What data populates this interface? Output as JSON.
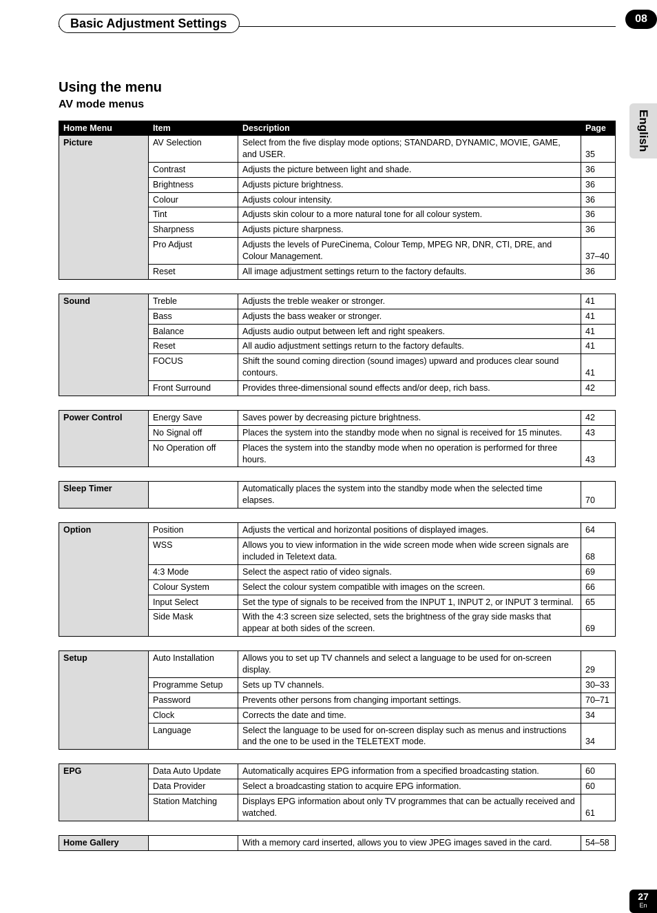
{
  "chapter": {
    "title": "Basic Adjustment Settings",
    "number": "08"
  },
  "side_tab": "English",
  "heading": "Using the menu",
  "subheading": "AV mode menus",
  "columns": {
    "menu": "Home Menu",
    "item": "Item",
    "desc": "Description",
    "page": "Page"
  },
  "tables": [
    {
      "menu": "Picture",
      "has_header": true,
      "rows": [
        {
          "item": "AV Selection",
          "desc": "Select from the five display mode options; STANDARD, DYNAMIC, MOVIE, GAME, and USER.",
          "page": "35"
        },
        {
          "item": "Contrast",
          "desc": "Adjusts the picture between light and shade.",
          "page": "36"
        },
        {
          "item": "Brightness",
          "desc": "Adjusts picture brightness.",
          "page": "36"
        },
        {
          "item": "Colour",
          "desc": "Adjusts colour intensity.",
          "page": "36"
        },
        {
          "item": "Tint",
          "desc": "Adjusts skin colour to a more natural tone for all colour system.",
          "page": "36"
        },
        {
          "item": "Sharpness",
          "desc": "Adjusts picture sharpness.",
          "page": "36"
        },
        {
          "item": "Pro Adjust",
          "desc": "Adjusts the levels of PureCinema, Colour Temp, MPEG NR, DNR, CTI, DRE, and Colour Management.",
          "page": "37–40"
        },
        {
          "item": "Reset",
          "desc": "All image adjustment settings return to the factory defaults.",
          "page": "36"
        }
      ]
    },
    {
      "menu": "Sound",
      "has_header": false,
      "rows": [
        {
          "item": "Treble",
          "desc": "Adjusts the treble weaker or stronger.",
          "page": "41"
        },
        {
          "item": "Bass",
          "desc": "Adjusts the bass weaker or stronger.",
          "page": "41"
        },
        {
          "item": "Balance",
          "desc": "Adjusts audio output between left and right speakers.",
          "page": "41"
        },
        {
          "item": "Reset",
          "desc": "All audio adjustment settings return to the factory defaults.",
          "page": "41"
        },
        {
          "item": "FOCUS",
          "desc": "Shift the sound coming direction (sound images) upward and produces clear sound contours.",
          "page": "41"
        },
        {
          "item": "Front Surround",
          "desc": "Provides three-dimensional sound effects and/or deep, rich bass.",
          "page": "42"
        }
      ]
    },
    {
      "menu": "Power Control",
      "has_header": false,
      "rows": [
        {
          "item": "Energy Save",
          "desc": "Saves power by decreasing picture brightness.",
          "page": "42"
        },
        {
          "item": "No Signal off",
          "desc": "Places the system into the standby mode when no signal is received for 15 minutes.",
          "page": "43"
        },
        {
          "item": "No Operation off",
          "desc": "Places the system into the standby mode when no operation is performed for three hours.",
          "page": "43"
        }
      ]
    },
    {
      "menu": "Sleep Timer",
      "has_header": false,
      "rows": [
        {
          "item": "",
          "desc": "Automatically places the system into the standby mode when the selected time elapses.",
          "page": "70"
        }
      ]
    },
    {
      "menu": "Option",
      "has_header": false,
      "rows": [
        {
          "item": "Position",
          "desc": "Adjusts the vertical and horizontal positions of displayed images.",
          "page": "64"
        },
        {
          "item": "WSS",
          "desc": "Allows you to view information in the wide screen mode when wide screen signals are included in Teletext data.",
          "page": "68"
        },
        {
          "item": "4:3 Mode",
          "desc": "Select the aspect ratio of video signals.",
          "page": "69"
        },
        {
          "item": "Colour System",
          "desc": "Select the colour system compatible with images on the screen.",
          "page": "66"
        },
        {
          "item": "Input Select",
          "desc": "Set the type of signals to be received from the INPUT 1, INPUT 2, or INPUT 3 terminal.",
          "page": "65"
        },
        {
          "item": "Side Mask",
          "desc": "With the 4:3 screen size selected, sets the brightness of the gray side masks that appear at both sides of the screen.",
          "page": "69"
        }
      ]
    },
    {
      "menu": "Setup",
      "has_header": false,
      "rows": [
        {
          "item": "Auto Installation",
          "desc": "Allows you to set up TV channels and select a language to be used for on-screen display.",
          "page": "29"
        },
        {
          "item": "Programme Setup",
          "desc": "Sets up TV channels.",
          "page": "30–33"
        },
        {
          "item": "Password",
          "desc": "Prevents other persons from changing important settings.",
          "page": "70–71"
        },
        {
          "item": "Clock",
          "desc": "Corrects the date and time.",
          "page": "34"
        },
        {
          "item": "Language",
          "desc": "Select the language to be used for on-screen display such as menus and instructions and the one to be used in the TELETEXT mode.",
          "page": "34"
        }
      ]
    },
    {
      "menu": "EPG",
      "has_header": false,
      "rows": [
        {
          "item": "Data Auto Update",
          "desc": "Automatically acquires EPG information from a specified broadcasting station.",
          "page": "60"
        },
        {
          "item": "Data Provider",
          "desc": "Select a broadcasting station to acquire EPG information.",
          "page": "60"
        },
        {
          "item": "Station Matching",
          "desc": "Displays EPG information about only TV programmes that can be actually received and watched.",
          "page": "61"
        }
      ]
    },
    {
      "menu": "Home Gallery",
      "has_header": false,
      "rows": [
        {
          "item": "",
          "desc": "With a memory card inserted, allows you to view JPEG images saved in the card.",
          "page": "54–58"
        }
      ]
    }
  ],
  "footer": {
    "page_number": "27",
    "lang_code": "En"
  }
}
